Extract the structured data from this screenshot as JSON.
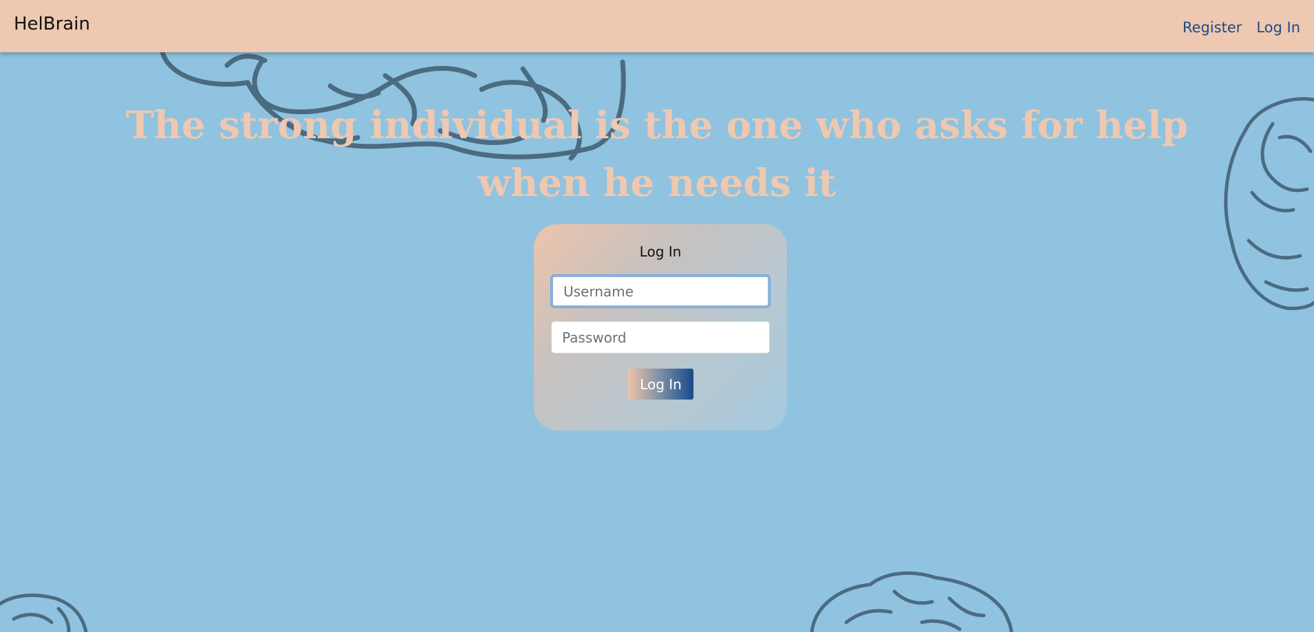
{
  "navbar": {
    "brand": "HelBrain",
    "links": [
      {
        "label": "Register"
      },
      {
        "label": "Log In"
      }
    ]
  },
  "hero": {
    "quote_line1": "The strong individual is the one who asks for help",
    "quote_line2": "when he needs it"
  },
  "login_form": {
    "title": "Log In",
    "username_placeholder": "Username",
    "password_placeholder": "Password",
    "submit_label": "Log In"
  },
  "colors": {
    "background": "#8fc3e0",
    "navbar": "#eec8b0",
    "quote": "#eec8b0",
    "link": "#1e4a8a",
    "brain_outline": "#4a6a80"
  }
}
